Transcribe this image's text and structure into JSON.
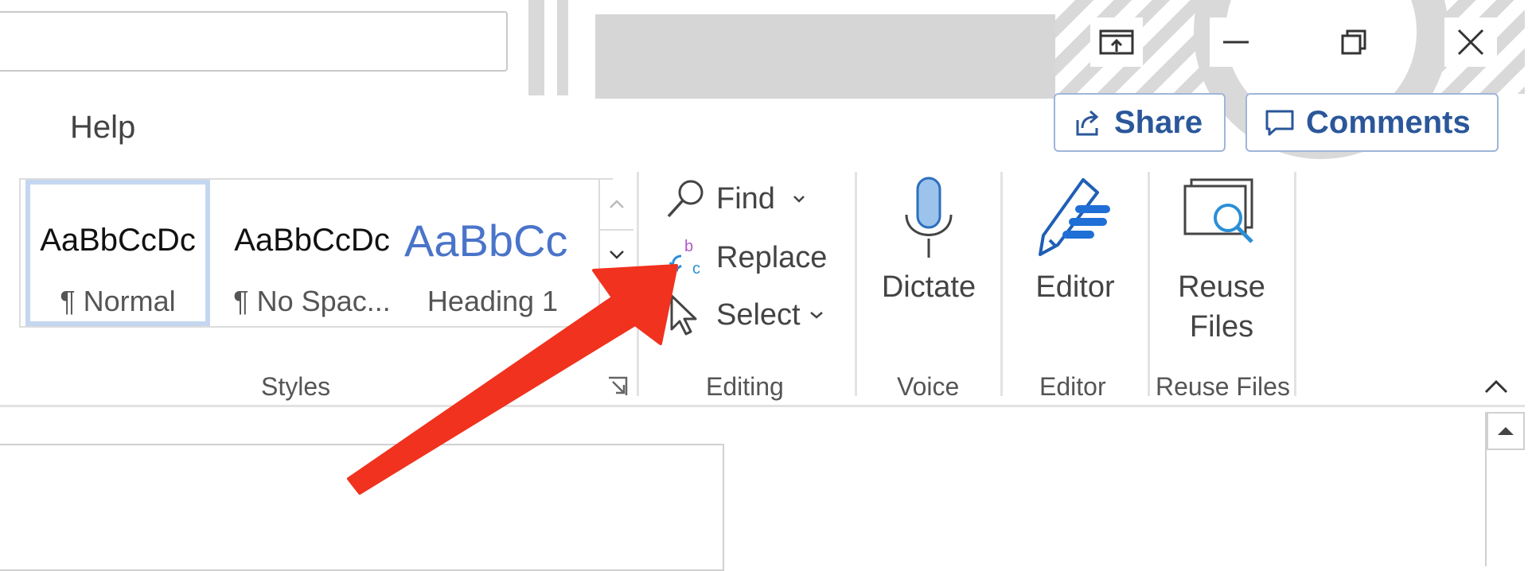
{
  "tabs": {
    "help": "Help"
  },
  "actions": {
    "share": "Share",
    "comments": "Comments"
  },
  "styles": {
    "group_label": "Styles",
    "items": [
      {
        "sample": "AaBbCcDc",
        "name": "¶ Normal"
      },
      {
        "sample": "AaBbCcDc",
        "name": "¶ No Spac..."
      },
      {
        "sample": "AaBbCc",
        "name": "Heading 1"
      }
    ]
  },
  "editing": {
    "group_label": "Editing",
    "find": "Find",
    "replace": "Replace",
    "select": "Select"
  },
  "voice": {
    "group_label": "Voice",
    "dictate": "Dictate"
  },
  "editor": {
    "group_label": "Editor",
    "editor": "Editor"
  },
  "reuse": {
    "group_label": "Reuse Files",
    "line1": "Reuse",
    "line2": "Files"
  },
  "colors": {
    "accent": "#2b579a",
    "annotation_arrow": "#f0321e",
    "heading_blue": "#4a74c9"
  }
}
